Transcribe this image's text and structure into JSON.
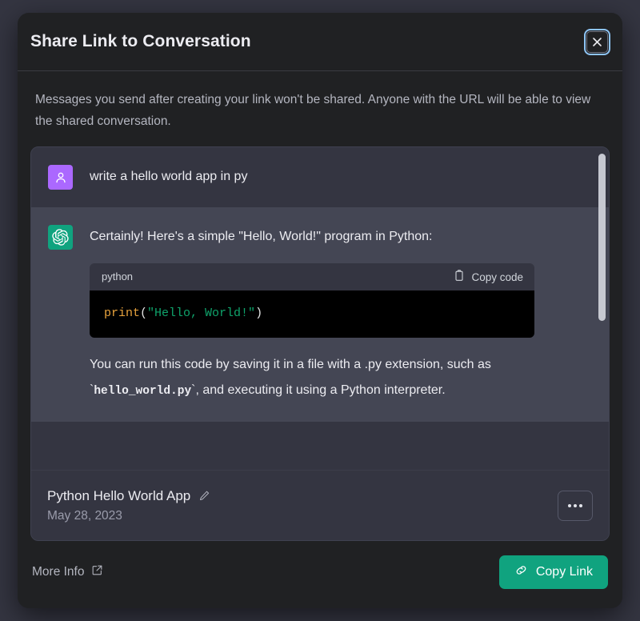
{
  "modal": {
    "title": "Share Link to Conversation",
    "close_icon": "close-icon",
    "description": "Messages you send after creating your link won't be shared. Anyone with the URL will be able to view the shared conversation."
  },
  "conversation": {
    "messages": [
      {
        "role": "user",
        "avatar_icon": "user-avatar-icon",
        "avatar_color": "#ab68ff",
        "text": "write a hello world app in py"
      },
      {
        "role": "assistant",
        "avatar_icon": "openai-logo-icon",
        "avatar_color": "#10a37f",
        "intro": "Certainly! Here's a simple \"Hello, World!\" program in Python:",
        "code_block": {
          "language": "python",
          "copy_label": "Copy code",
          "copy_icon": "clipboard-icon",
          "tokens": {
            "fn": "print",
            "open_paren": "(",
            "string": "\"Hello, World!\"",
            "close_paren": ")"
          },
          "full_code": "print(\"Hello, World!\")",
          "colors": {
            "function": "#e8a33d",
            "string": "#0fa36b",
            "punctuation": "#e6e6e6",
            "background": "#000000"
          }
        },
        "outro_part1": "You can run this code by saving it in a file with a .py extension, such as `",
        "outro_code": "hello_world.py",
        "outro_part2": "`, and executing it using a Python interpreter."
      }
    ],
    "footer": {
      "name": "Python Hello World App",
      "edit_icon": "pencil-edit-icon",
      "date": "May 28, 2023",
      "more_icon": "ellipsis-icon"
    }
  },
  "footer": {
    "more_info_label": "More Info",
    "more_info_icon": "external-link-icon",
    "copy_link_label": "Copy Link",
    "copy_link_icon": "link-chain-icon",
    "copy_link_color": "#10a37f"
  }
}
